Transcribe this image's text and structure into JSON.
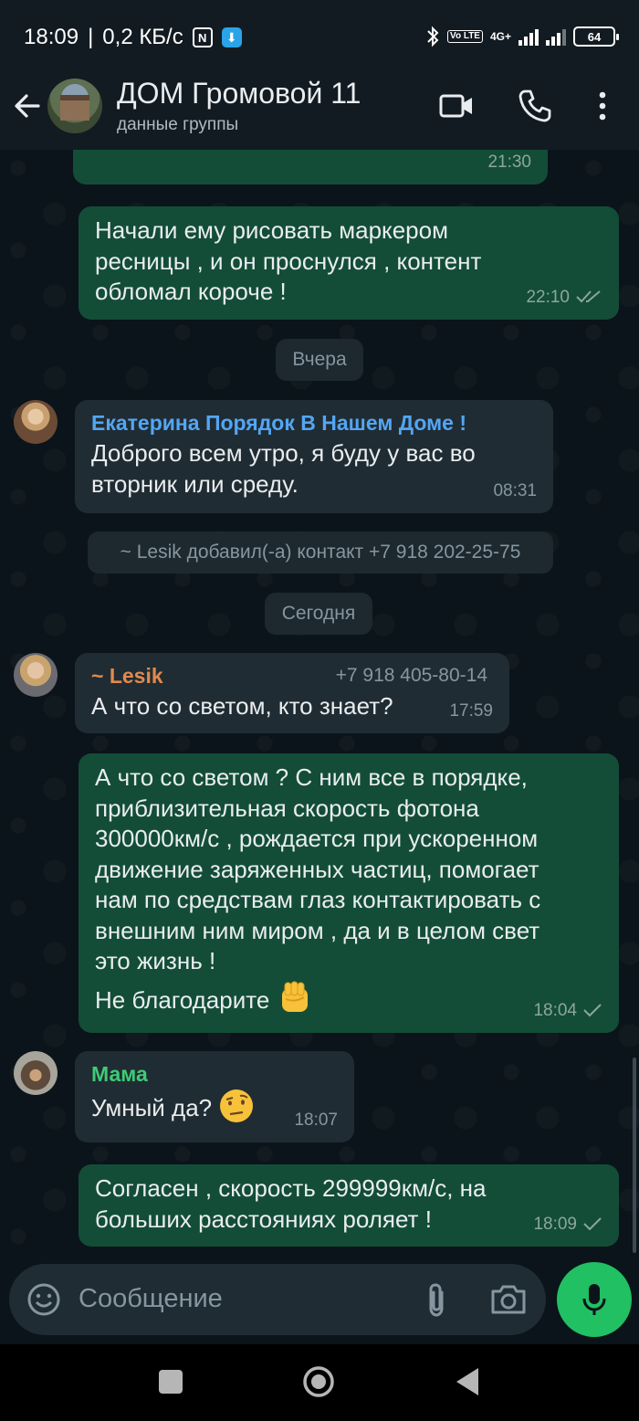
{
  "status_bar": {
    "time": "18:09",
    "speed": "0,2 КБ/с",
    "net_type": "4G+",
    "volte": "Vo LTE",
    "battery": "64"
  },
  "header": {
    "title": "ДОМ Громовой 11",
    "subtitle": "данные группы"
  },
  "messages": [
    {
      "time": "21:30"
    },
    {
      "text": "Начали ему рисовать маркером ресницы , и он проснулся , контент обломал короче !",
      "lines": [
        "Начали ему рисовать маркером",
        "ресницы , и он проснулся , контент",
        "обломал короче !"
      ],
      "time": "22:10",
      "status": "read"
    },
    {
      "sender": "Екатерина Порядок В Нашем Доме !",
      "lines": [
        "Доброго всем утро, я буду у вас во",
        "вторник или среду."
      ],
      "time": "08:31"
    },
    {
      "sender": "~ Lesik",
      "phone": "+7 918 405-80-14",
      "text": "А что со светом, кто знает?",
      "time": "17:59"
    },
    {
      "lines": [
        "А что со светом ? С ним все в порядке,",
        "приблизительная скорость фотона",
        "300000км/с , рождается при ускоренном",
        "движение заряженных частиц, помогает",
        "нам по средствам глаз контактировать с",
        "внешним ним миром , да и в целом свет",
        "это жизнь !"
      ],
      "last_line": "Не благодарите",
      "time": "18:04",
      "status": "sent"
    },
    {
      "sender": "Мама",
      "text": "Умный да?",
      "time": "18:07"
    },
    {
      "lines": [
        "Согласен , скорость 299999км/с, на",
        "больших расстояниях роляет !"
      ],
      "time": "18:09",
      "status": "sent"
    }
  ],
  "system": {
    "date_yesterday": "Вчера",
    "added_contact": "~ Lesik добавил(-а) контакт +7 918 202-25-75",
    "date_today": "Сегодня"
  },
  "composer": {
    "placeholder": "Сообщение"
  },
  "colors": {
    "outgoing_bubble": "#134d37",
    "incoming_bubble": "#202c33",
    "sender_ekaterina": "#53a6f3",
    "sender_lesik": "#e08a4d",
    "sender_mama": "#3ecb74",
    "accent_green": "#21c063"
  }
}
